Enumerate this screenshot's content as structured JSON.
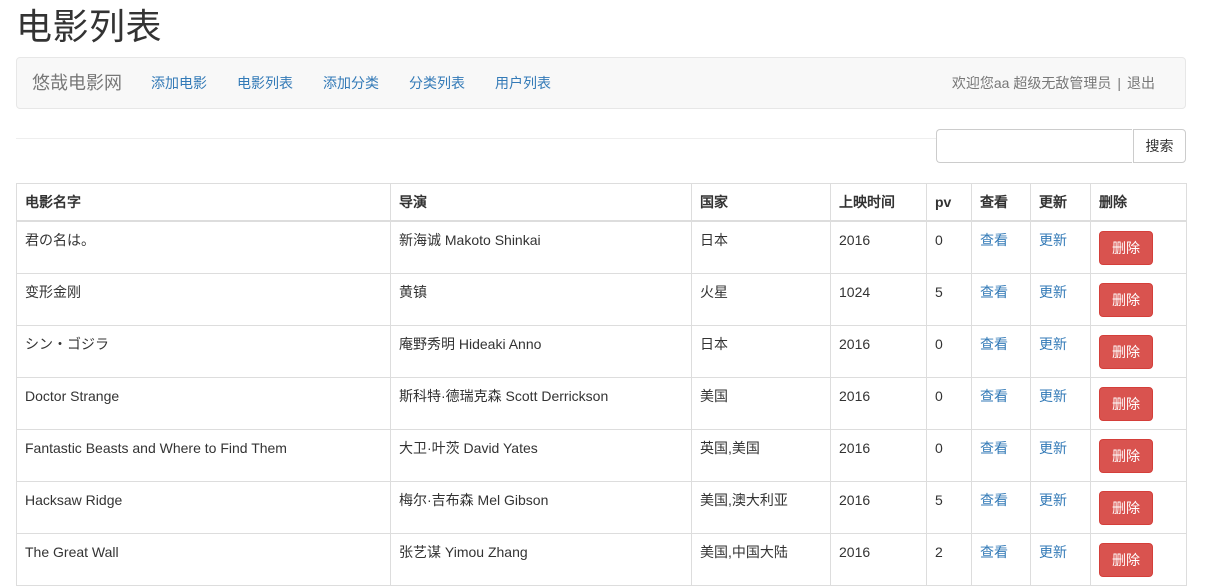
{
  "page": {
    "title": "电影列表"
  },
  "navbar": {
    "brand": "悠哉电影网",
    "links": [
      "添加电影",
      "电影列表",
      "添加分类",
      "分类列表",
      "用户列表"
    ],
    "welcome": "欢迎您aa 超级无敌管理员",
    "separator": "|",
    "logout": "退出"
  },
  "search": {
    "button_label": "搜索",
    "value": ""
  },
  "table": {
    "headers": [
      "电影名字",
      "导演",
      "国家",
      "上映时间",
      "pv",
      "查看",
      "更新",
      "删除"
    ],
    "view_label": "查看",
    "update_label": "更新",
    "delete_label": "删除",
    "rows": [
      {
        "name": "君の名は。",
        "director": "新海诚 Makoto Shinkai",
        "country": "日本",
        "year": "2016",
        "pv": "0"
      },
      {
        "name": "变形金刚",
        "director": "黄镇",
        "country": "火星",
        "year": "1024",
        "pv": "5"
      },
      {
        "name": "シン・ゴジラ",
        "director": "庵野秀明 Hideaki Anno",
        "country": "日本",
        "year": "2016",
        "pv": "0"
      },
      {
        "name": "Doctor Strange",
        "director": "斯科特·德瑞克森 Scott Derrickson",
        "country": "美国",
        "year": "2016",
        "pv": "0"
      },
      {
        "name": "Fantastic Beasts and Where to Find Them",
        "director": "大卫·叶茨 David Yates",
        "country": "英国,美国",
        "year": "2016",
        "pv": "0"
      },
      {
        "name": "Hacksaw Ridge",
        "director": "梅尔·吉布森 Mel Gibson",
        "country": "美国,澳大利亚",
        "year": "2016",
        "pv": "5"
      },
      {
        "name": "The Great Wall",
        "director": "张艺谋 Yimou Zhang",
        "country": "美国,中国大陆",
        "year": "2016",
        "pv": "2"
      }
    ]
  },
  "colors": {
    "link": "#337ab7",
    "danger": "#d9534f",
    "navbar_bg": "#f8f8f8"
  }
}
